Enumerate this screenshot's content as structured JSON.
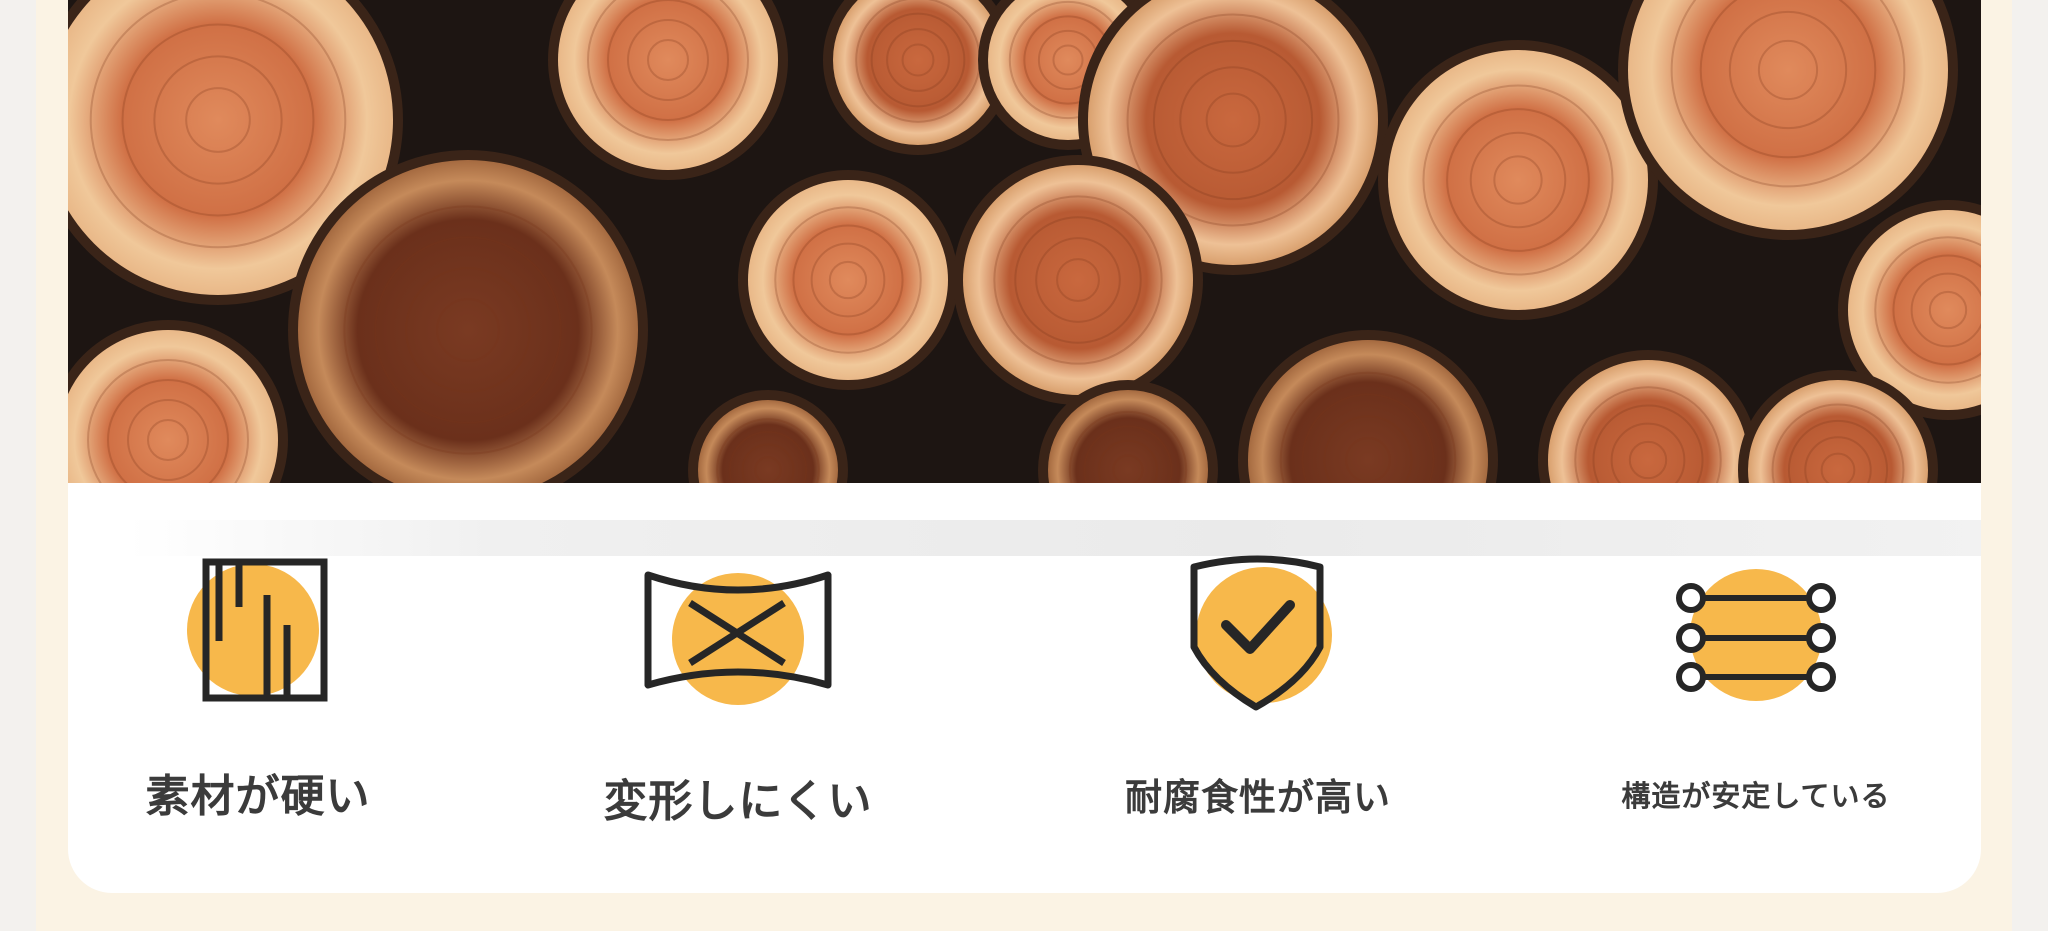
{
  "photo": {
    "subject": "stacked-cut-logs"
  },
  "features": [
    {
      "label": "素材が硬い",
      "icon": "wood-grain-icon"
    },
    {
      "label": "変形しにくい",
      "icon": "no-deformation-icon"
    },
    {
      "label": "耐腐食性が高い",
      "icon": "shield-check-icon"
    },
    {
      "label": "構造が安定している",
      "icon": "stable-structure-icon"
    }
  ],
  "colors": {
    "accent": "#f7b84b",
    "icon_stroke": "#262626",
    "label_text": "#3b3b3b",
    "frame_bg": "#fbf3e4",
    "card_bg": "#ffffff"
  }
}
